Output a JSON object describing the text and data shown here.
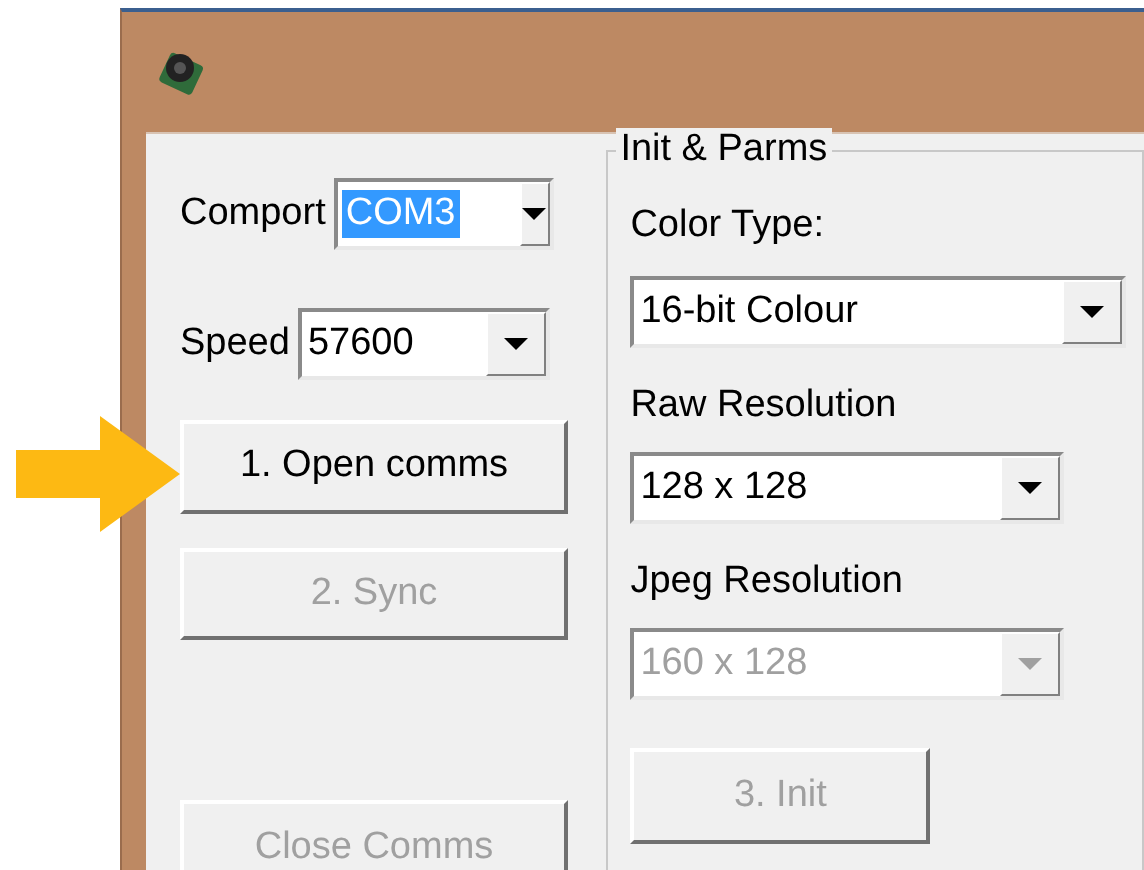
{
  "comport": {
    "label": "Comport",
    "value": "COM3",
    "highlighted": true
  },
  "speed": {
    "label": "Speed",
    "value": "57600",
    "highlighted": false
  },
  "buttons": [
    {
      "label": "1. Open comms",
      "disabled": false
    },
    {
      "label": "2. Sync",
      "disabled": true
    },
    {
      "label": "Close Comms",
      "disabled": true
    }
  ],
  "group": {
    "legend": "Init & Parms",
    "fields": [
      {
        "label": "Color Type:",
        "value": "16-bit Colour",
        "disabled": false,
        "wide": true
      },
      {
        "label": "Raw Resolution",
        "value": "128 x 128",
        "disabled": false,
        "wide": false
      },
      {
        "label": "Jpeg Resolution",
        "value": "160 x 128",
        "disabled": true,
        "wide": false
      }
    ],
    "button": {
      "label": "3. Init",
      "disabled": true
    }
  }
}
